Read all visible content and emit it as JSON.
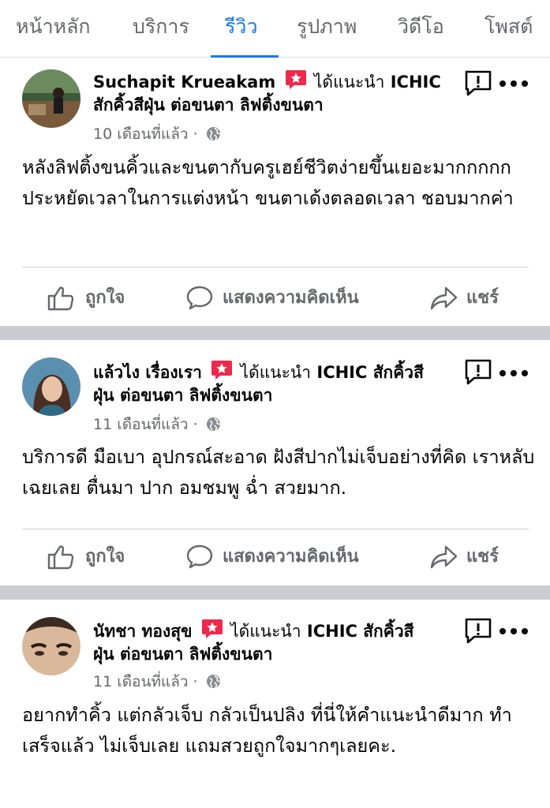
{
  "tabs": [
    "หน้าหลัก",
    "บริการ",
    "รีวิว",
    "รูปภาพ",
    "วิดีโอ",
    "โพสต์"
  ],
  "active_tab": "รีวิว",
  "recommend_prefix": "ได้แนะนำ",
  "actions": {
    "like": "ถูกใจ",
    "comment": "แสดงความคิดเห็น",
    "share": "แชร์"
  },
  "reviews": [
    {
      "author": "Suchapit Krueakam",
      "page_line1": "ICHIC",
      "page_line2": "สักคิ้วสีฝุ่น ต่อขนตา ลิฟติ้งขนตา",
      "time": "10 เดือนที่แล้ว",
      "text": "หลังลิฟติ้งขนคิ้วและขนตากับครูเฮย์ชีวิตง่ายขึ้นเยอะมากกกกก ประหยัดเวลาในการแต่งหน้า ขนตาเด้งตลอดเวลา ชอบมากค่า"
    },
    {
      "author": "แล้วไง เรื่องเรา",
      "page_line1": "ICHIC สักคิ้วสี",
      "page_line2": "ฝุ่น ต่อขนตา ลิฟติ้งขนตา",
      "time": "11 เดือนที่แล้ว",
      "text": "บริการดี มือเบา อุปกรณ์สะอาด ฝังสีปากไม่เจ็บอย่างที่คิด เราหลับเฉยเลย  ตื่นมา  ปาก อมชมพู ฉ่ำ สวยมาก."
    },
    {
      "author": "นัทชา ทองสุข",
      "page_line1": "ICHIC สักคิ้วสี",
      "page_line2": "ฝุ่น ต่อขนตา ลิฟติ้งขนตา",
      "time": "11 เดือนที่แล้ว",
      "text": "อยากทำคิ้ว แต่กลัวเจ็บ กลัวเป็นปลิง ที่นี่ให้คำแนะนำดีมาก ทำเสร็จแล้ว ไม่เจ็บเลย แถมสวยถูกใจมากๆเลยคะ."
    }
  ],
  "colors": {
    "accent": "#1877f2",
    "badge": "#f02849",
    "secondary_text": "#65676b",
    "separator": "#c9ccd1"
  }
}
